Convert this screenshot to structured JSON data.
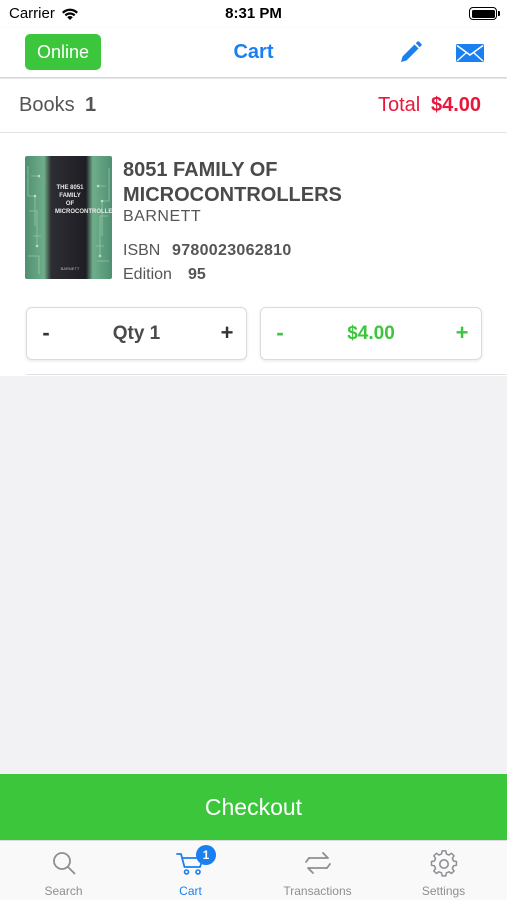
{
  "status_bar": {
    "carrier": "Carrier",
    "time": "8:31 PM"
  },
  "nav": {
    "online_label": "Online",
    "title": "Cart",
    "icons": [
      "pencil-icon",
      "envelope-icon"
    ]
  },
  "summary": {
    "books_label": "Books",
    "books_count": "1",
    "total_label": "Total",
    "total_value": "$4.00"
  },
  "cart_items": [
    {
      "title": "8051 FAMILY OF MICROCONTROLLERS",
      "author": "BARNETT",
      "isbn_label": "ISBN",
      "isbn": "9780023062810",
      "edition_label": "Edition",
      "edition": "95",
      "cover_text": "THE 8051 FAMILY OF MICROCONTROLLERS",
      "quantity": {
        "minus": "-",
        "label": "Qty 1",
        "plus": "+"
      },
      "price": {
        "minus": "-",
        "label": "$4.00",
        "plus": "+"
      }
    }
  ],
  "checkout": {
    "label": "Checkout"
  },
  "tabs": [
    {
      "label": "Search",
      "icon": "search-icon",
      "active": false
    },
    {
      "label": "Cart",
      "icon": "cart-icon",
      "active": true,
      "badge": "1"
    },
    {
      "label": "Transactions",
      "icon": "transactions-icon",
      "active": false
    },
    {
      "label": "Settings",
      "icon": "gear-icon",
      "active": false
    }
  ],
  "colors": {
    "accent_blue": "#1a7ff0",
    "green": "#3cc63c",
    "total_red": "#e8173b"
  }
}
